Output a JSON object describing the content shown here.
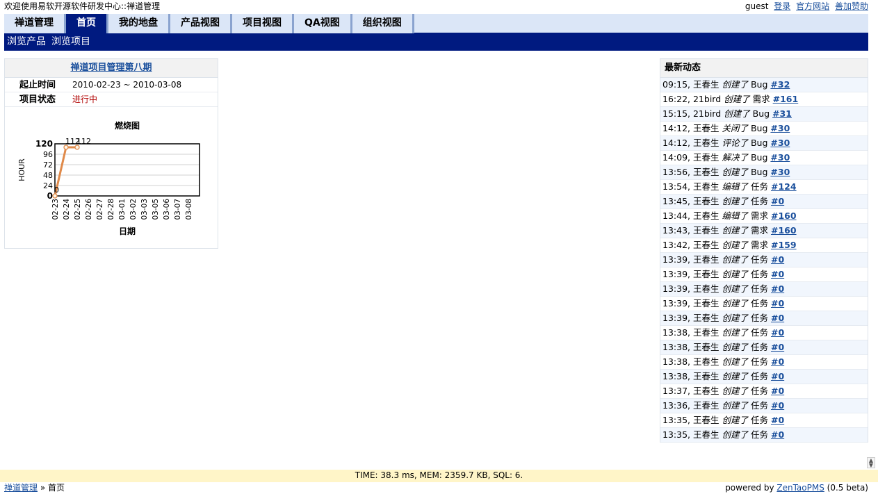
{
  "header": {
    "welcome": "欢迎使用易软开源软件研发中心::禅道管理",
    "user": "guest",
    "links": [
      "登录",
      "官方网站",
      "善加赞助"
    ]
  },
  "nav": {
    "tabs": [
      "禅道管理",
      "首页",
      "我的地盘",
      "产品视图",
      "项目视图",
      "QA视图",
      "组织视图"
    ],
    "active_index": 1
  },
  "subnav": {
    "items": [
      "浏览产品",
      "浏览项目"
    ]
  },
  "project": {
    "title": "禅道项目管理第八期",
    "rows": [
      {
        "label": "起止时间",
        "value": "2010-02-23 ~ 2010-03-08"
      },
      {
        "label": "项目状态",
        "value": "进行中"
      }
    ]
  },
  "chart_data": {
    "type": "line",
    "title": "燃烧图",
    "xlabel": "日期",
    "ylabel": "HOUR",
    "categories": [
      "02-23",
      "02-24",
      "02-25",
      "02-26",
      "02-27",
      "02-28",
      "03-01",
      "03-02",
      "03-03",
      "03-05",
      "03-06",
      "03-07",
      "03-08"
    ],
    "series": [
      {
        "values": [
          0,
          112,
          112
        ]
      }
    ],
    "data_labels": [
      "0",
      "112",
      "112"
    ],
    "yticks": [
      0,
      24,
      48,
      72,
      96,
      120
    ],
    "ylim": [
      0,
      120
    ],
    "grid": true,
    "colors": {
      "line": "#e08a4a",
      "point_fill": "#fff7e8"
    }
  },
  "feed": {
    "title": "最新动态",
    "items": [
      {
        "time": "09:15",
        "user": "王春生",
        "action": "创建了",
        "type": "Bug",
        "id": "#32"
      },
      {
        "time": "16:22",
        "user": "21bird",
        "action": "创建了",
        "type": "需求",
        "id": "#161"
      },
      {
        "time": "15:15",
        "user": "21bird",
        "action": "创建了",
        "type": "Bug",
        "id": "#31"
      },
      {
        "time": "14:12",
        "user": "王春生",
        "action": "关闭了",
        "type": "Bug",
        "id": "#30"
      },
      {
        "time": "14:12",
        "user": "王春生",
        "action": "评论了",
        "type": "Bug",
        "id": "#30"
      },
      {
        "time": "14:09",
        "user": "王春生",
        "action": "解决了",
        "type": "Bug",
        "id": "#30"
      },
      {
        "time": "13:56",
        "user": "王春生",
        "action": "创建了",
        "type": "Bug",
        "id": "#30"
      },
      {
        "time": "13:54",
        "user": "王春生",
        "action": "编辑了",
        "type": "任务",
        "id": "#124"
      },
      {
        "time": "13:45",
        "user": "王春生",
        "action": "创建了",
        "type": "任务",
        "id": "#0"
      },
      {
        "time": "13:44",
        "user": "王春生",
        "action": "编辑了",
        "type": "需求",
        "id": "#160"
      },
      {
        "time": "13:43",
        "user": "王春生",
        "action": "创建了",
        "type": "需求",
        "id": "#160"
      },
      {
        "time": "13:42",
        "user": "王春生",
        "action": "创建了",
        "type": "需求",
        "id": "#159"
      },
      {
        "time": "13:39",
        "user": "王春生",
        "action": "创建了",
        "type": "任务",
        "id": "#0"
      },
      {
        "time": "13:39",
        "user": "王春生",
        "action": "创建了",
        "type": "任务",
        "id": "#0"
      },
      {
        "time": "13:39",
        "user": "王春生",
        "action": "创建了",
        "type": "任务",
        "id": "#0"
      },
      {
        "time": "13:39",
        "user": "王春生",
        "action": "创建了",
        "type": "任务",
        "id": "#0"
      },
      {
        "time": "13:39",
        "user": "王春生",
        "action": "创建了",
        "type": "任务",
        "id": "#0"
      },
      {
        "time": "13:38",
        "user": "王春生",
        "action": "创建了",
        "type": "任务",
        "id": "#0"
      },
      {
        "time": "13:38",
        "user": "王春生",
        "action": "创建了",
        "type": "任务",
        "id": "#0"
      },
      {
        "time": "13:38",
        "user": "王春生",
        "action": "创建了",
        "type": "任务",
        "id": "#0"
      },
      {
        "time": "13:38",
        "user": "王春生",
        "action": "创建了",
        "type": "任务",
        "id": "#0"
      },
      {
        "time": "13:37",
        "user": "王春生",
        "action": "创建了",
        "type": "任务",
        "id": "#0"
      },
      {
        "time": "13:36",
        "user": "王春生",
        "action": "创建了",
        "type": "任务",
        "id": "#0"
      },
      {
        "time": "13:35",
        "user": "王春生",
        "action": "创建了",
        "type": "任务",
        "id": "#0"
      },
      {
        "time": "13:35",
        "user": "王春生",
        "action": "创建了",
        "type": "任务",
        "id": "#0"
      }
    ]
  },
  "footer": {
    "stats": "TIME: 38.3 ms, MEM: 2359.7 KB, SQL: 6.",
    "breadcrumb_root": "禅道管理",
    "breadcrumb_sep": "»",
    "breadcrumb_current": "首页",
    "powered_prefix": "powered by",
    "powered_link": "ZenTaoPMS",
    "powered_suffix": "(0.5 beta)"
  }
}
